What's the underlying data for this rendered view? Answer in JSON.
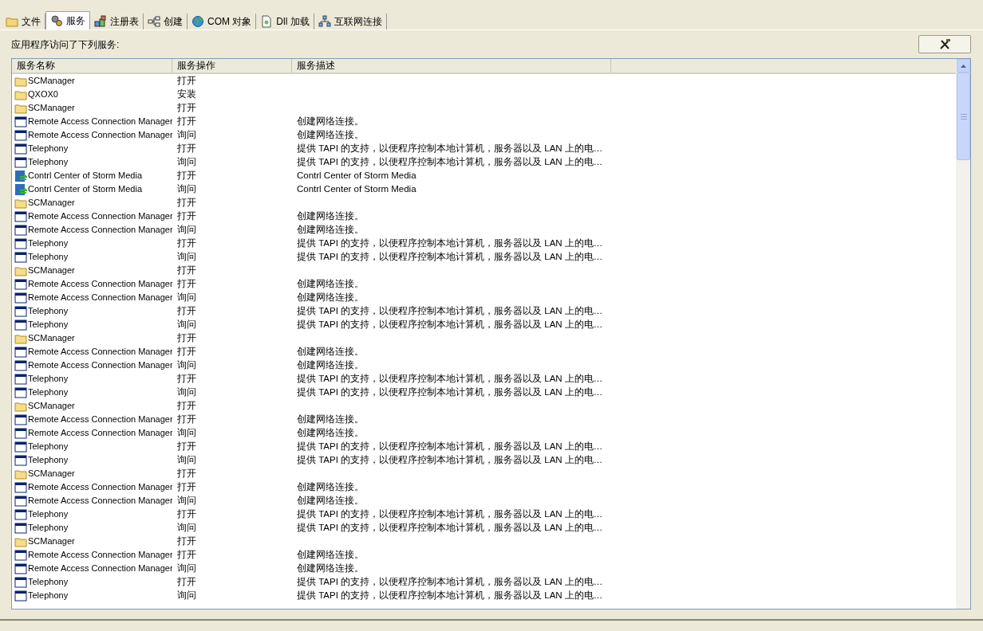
{
  "tabs": [
    {
      "label": "文件",
      "selected": false
    },
    {
      "label": "服务",
      "selected": true
    },
    {
      "label": "注册表",
      "selected": false
    },
    {
      "label": "创建",
      "selected": false
    },
    {
      "label": "COM 对象",
      "selected": false
    },
    {
      "label": "Dll 加载",
      "selected": false
    },
    {
      "label": "互联网连接",
      "selected": false
    }
  ],
  "caption": "应用程序访问了下列服务:",
  "table": {
    "columns": [
      "服务名称",
      "服务操作",
      "服务描述"
    ],
    "rows": [
      {
        "kind": "folder",
        "name": "SCManager",
        "action": "打开",
        "description": ""
      },
      {
        "kind": "folder",
        "name": "QXOX0",
        "action": "安装",
        "description": ""
      },
      {
        "kind": "folder",
        "name": "SCManager",
        "action": "打开",
        "description": ""
      },
      {
        "kind": "window",
        "name": "Remote Access Connection Manager",
        "action": "打开",
        "description": "创建网络连接。"
      },
      {
        "kind": "window",
        "name": "Remote Access Connection Manager",
        "action": "询问",
        "description": "创建网络连接。"
      },
      {
        "kind": "window",
        "name": "Telephony",
        "action": "打开",
        "description": "提供 TAPI 的支持，以便程序控制本地计算机，服务器以及 LAN 上的电…"
      },
      {
        "kind": "window",
        "name": "Telephony",
        "action": "询问",
        "description": "提供 TAPI 的支持，以便程序控制本地计算机，服务器以及 LAN 上的电…"
      },
      {
        "kind": "media",
        "name": "Contrl Center of Storm Media",
        "action": "打开",
        "description": "Contrl Center of Storm Media"
      },
      {
        "kind": "media",
        "name": "Contrl Center of Storm Media",
        "action": "询问",
        "description": "Contrl Center of Storm Media"
      },
      {
        "kind": "folder",
        "name": "SCManager",
        "action": "打开",
        "description": ""
      },
      {
        "kind": "window",
        "name": "Remote Access Connection Manager",
        "action": "打开",
        "description": "创建网络连接。"
      },
      {
        "kind": "window",
        "name": "Remote Access Connection Manager",
        "action": "询问",
        "description": "创建网络连接。"
      },
      {
        "kind": "window",
        "name": "Telephony",
        "action": "打开",
        "description": "提供 TAPI 的支持，以便程序控制本地计算机，服务器以及 LAN 上的电…"
      },
      {
        "kind": "window",
        "name": "Telephony",
        "action": "询问",
        "description": "提供 TAPI 的支持，以便程序控制本地计算机，服务器以及 LAN 上的电…"
      },
      {
        "kind": "folder",
        "name": "SCManager",
        "action": "打开",
        "description": ""
      },
      {
        "kind": "window",
        "name": "Remote Access Connection Manager",
        "action": "打开",
        "description": "创建网络连接。"
      },
      {
        "kind": "window",
        "name": "Remote Access Connection Manager",
        "action": "询问",
        "description": "创建网络连接。"
      },
      {
        "kind": "window",
        "name": "Telephony",
        "action": "打开",
        "description": "提供 TAPI 的支持，以便程序控制本地计算机，服务器以及 LAN 上的电…"
      },
      {
        "kind": "window",
        "name": "Telephony",
        "action": "询问",
        "description": "提供 TAPI 的支持，以便程序控制本地计算机，服务器以及 LAN 上的电…"
      },
      {
        "kind": "folder",
        "name": "SCManager",
        "action": "打开",
        "description": ""
      },
      {
        "kind": "window",
        "name": "Remote Access Connection Manager",
        "action": "打开",
        "description": "创建网络连接。"
      },
      {
        "kind": "window",
        "name": "Remote Access Connection Manager",
        "action": "询问",
        "description": "创建网络连接。"
      },
      {
        "kind": "window",
        "name": "Telephony",
        "action": "打开",
        "description": "提供 TAPI 的支持，以便程序控制本地计算机，服务器以及 LAN 上的电…"
      },
      {
        "kind": "window",
        "name": "Telephony",
        "action": "询问",
        "description": "提供 TAPI 的支持，以便程序控制本地计算机，服务器以及 LAN 上的电…"
      },
      {
        "kind": "folder",
        "name": "SCManager",
        "action": "打开",
        "description": ""
      },
      {
        "kind": "window",
        "name": "Remote Access Connection Manager",
        "action": "打开",
        "description": "创建网络连接。"
      },
      {
        "kind": "window",
        "name": "Remote Access Connection Manager",
        "action": "询问",
        "description": "创建网络连接。"
      },
      {
        "kind": "window",
        "name": "Telephony",
        "action": "打开",
        "description": "提供 TAPI 的支持，以便程序控制本地计算机，服务器以及 LAN 上的电…"
      },
      {
        "kind": "window",
        "name": "Telephony",
        "action": "询问",
        "description": "提供 TAPI 的支持，以便程序控制本地计算机，服务器以及 LAN 上的电…"
      },
      {
        "kind": "folder",
        "name": "SCManager",
        "action": "打开",
        "description": ""
      },
      {
        "kind": "window",
        "name": "Remote Access Connection Manager",
        "action": "打开",
        "description": "创建网络连接。"
      },
      {
        "kind": "window",
        "name": "Remote Access Connection Manager",
        "action": "询问",
        "description": "创建网络连接。"
      },
      {
        "kind": "window",
        "name": "Telephony",
        "action": "打开",
        "description": "提供 TAPI 的支持，以便程序控制本地计算机，服务器以及 LAN 上的电…"
      },
      {
        "kind": "window",
        "name": "Telephony",
        "action": "询问",
        "description": "提供 TAPI 的支持，以便程序控制本地计算机，服务器以及 LAN 上的电…"
      },
      {
        "kind": "folder",
        "name": "SCManager",
        "action": "打开",
        "description": ""
      },
      {
        "kind": "window",
        "name": "Remote Access Connection Manager",
        "action": "打开",
        "description": "创建网络连接。"
      },
      {
        "kind": "window",
        "name": "Remote Access Connection Manager",
        "action": "询问",
        "description": "创建网络连接。"
      },
      {
        "kind": "window",
        "name": "Telephony",
        "action": "打开",
        "description": "提供 TAPI 的支持，以便程序控制本地计算机，服务器以及 LAN 上的电…"
      },
      {
        "kind": "window",
        "name": "Telephony",
        "action": "询问",
        "description": "提供 TAPI 的支持，以便程序控制本地计算机，服务器以及 LAN 上的电…"
      }
    ]
  }
}
